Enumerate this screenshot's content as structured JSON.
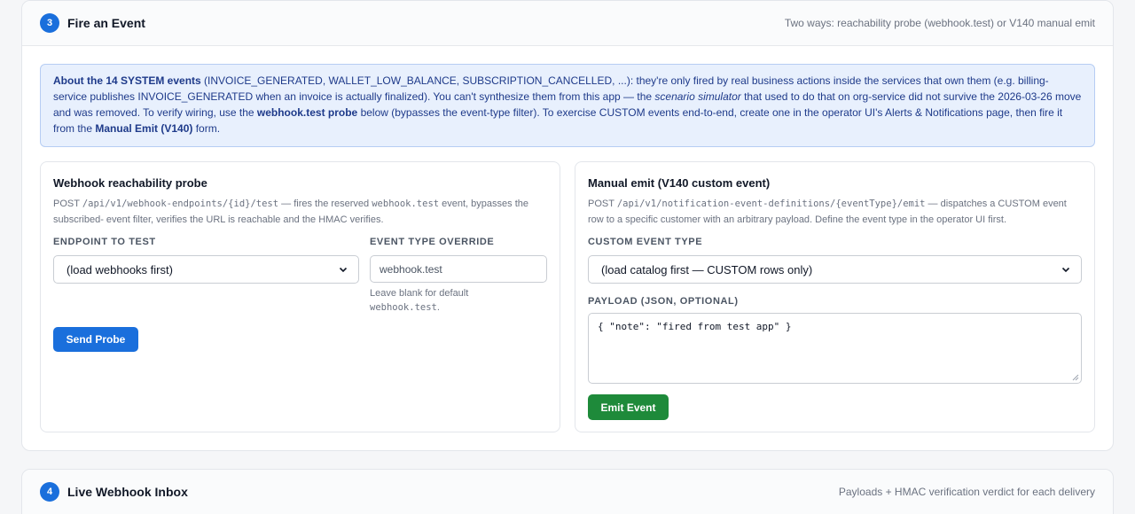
{
  "section3": {
    "step": "3",
    "title": "Fire an Event",
    "hint": "Two ways: reachability probe (webhook.test) or V140 manual emit",
    "info": {
      "p1_bold": "About the 14 SYSTEM events",
      "p1": " (INVOICE_GENERATED, WALLET_LOW_BALANCE, SUBSCRIPTION_CANCELLED, ...): they're only fired by real business actions inside the services that own them (e.g. billing-service publishes INVOICE_GENERATED when an invoice is actually finalized). You can't synthesize them from this app — the ",
      "p2_em": "scenario simulator",
      "p2": " that used to do that on org-service did not survive the 2026-03-26 move and was removed. To verify wiring, use the ",
      "p3_bold": "webhook.test probe",
      "p3": " below (bypasses the event-type filter). To exercise CUSTOM events end-to-end, create one in the operator UI's Alerts & Notifications page, then fire it from the ",
      "p4_bold": "Manual Emit (V140)",
      "p4": " form."
    },
    "probe": {
      "title": "Webhook reachability probe",
      "desc_pre": "POST ",
      "desc_code1": "/api/v1/webhook-endpoints/{id}/test",
      "desc_mid": " — fires the reserved ",
      "desc_code2": "webhook.test",
      "desc_post": " event, bypasses the subscribed- event filter, verifies the URL is reachable and the HMAC verifies.",
      "endpoint_label": "Endpoint to test",
      "endpoint_value": "(load webhooks first)",
      "override_label": "Event type override",
      "override_placeholder": "webhook.test",
      "override_help": "Leave blank for default",
      "override_help_code": "webhook.test",
      "override_help_end": ".",
      "button": "Send Probe"
    },
    "emit": {
      "title": "Manual emit (V140 custom event)",
      "desc_pre": "POST ",
      "desc_code": "/api/v1/notification-event-definitions/{eventType}/emit",
      "desc_post": " — dispatches a CUSTOM event row to a specific customer with an arbitrary payload. Define the event type in the operator UI first.",
      "type_label": "Custom event type",
      "type_value": "(load catalog first — CUSTOM rows only)",
      "payload_label": "Payload (JSON, optional)",
      "payload_value": "{ \"note\": \"fired from test app\" }",
      "button": "Emit Event"
    }
  },
  "section4": {
    "step": "4",
    "title": "Live Webhook Inbox",
    "hint": "Payloads + HMAC verification verdict for each delivery"
  },
  "colors": {
    "accent": "#1a6fdc",
    "emit_green": "#1e8a3a",
    "info_bg": "#e8f0fd"
  }
}
